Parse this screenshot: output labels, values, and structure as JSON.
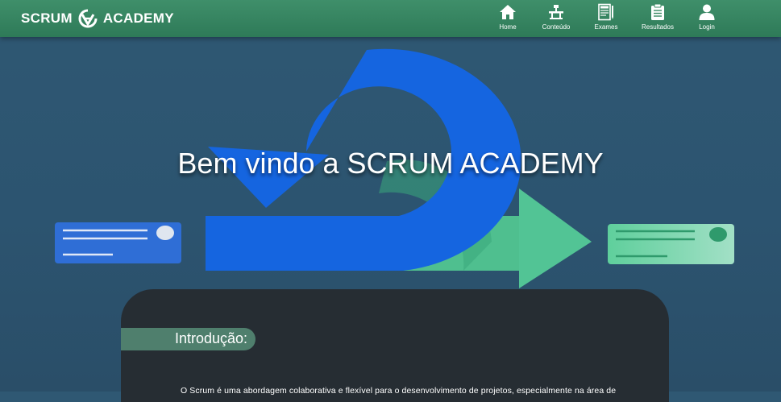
{
  "brand": {
    "name": "SCRUM",
    "name_suffix": "ACADEMY",
    "logo_icon": "scrum-logo-icon"
  },
  "nav": {
    "items": [
      {
        "label": "Home",
        "icon": "home-icon"
      },
      {
        "label": "Conteúdo",
        "icon": "content-icon"
      },
      {
        "label": "Exames",
        "icon": "exam-icon"
      },
      {
        "label": "Resultados",
        "icon": "clipboard-icon"
      },
      {
        "label": "Login",
        "icon": "user-icon"
      }
    ]
  },
  "hero": {
    "title": "Bem vindo a SCRUM ACADEMY"
  },
  "content": {
    "section_title": "Introdução:",
    "intro_text": "O Scrum é uma abordagem colaborativa e flexível para o desenvolvimento de projetos, especialmente na área de"
  },
  "colors": {
    "nav_green": "#3a8a64",
    "background": "#2f5873",
    "loop_blue": "#1565e0",
    "arrow_green": "#52c495",
    "card_dark": "#262d33",
    "pill_green": "#4f7f6d"
  }
}
